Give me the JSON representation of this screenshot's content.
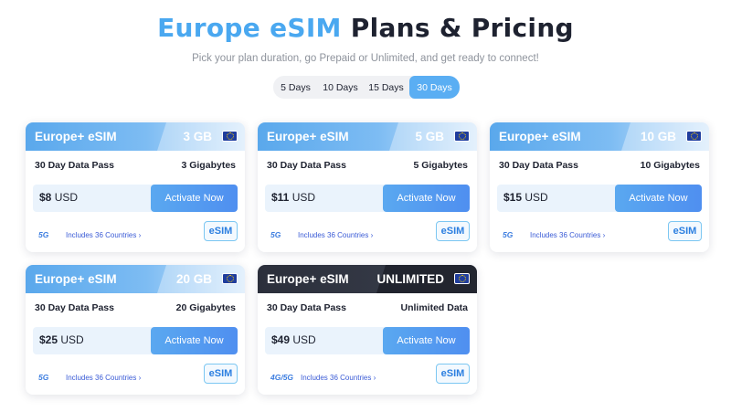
{
  "header": {
    "title_accent": "Europe eSIM",
    "title_rest": "Plans & Pricing",
    "subtitle": "Pick your plan duration, go Prepaid or Unlimited, and get ready to connect!"
  },
  "tabs": [
    {
      "label": "5 Days",
      "active": false
    },
    {
      "label": "10 Days",
      "active": false
    },
    {
      "label": "15 Days",
      "active": false
    },
    {
      "label": "30 Days",
      "active": true
    }
  ],
  "cards": [
    {
      "brand": "Europe+ eSIM",
      "data": "3 GB",
      "pass": "30 Day Data Pass",
      "amount": "3 Gigabytes",
      "price": "$8",
      "currency": "USD",
      "button": "Activate Now",
      "network": "5G",
      "countries": "Includes 36 Countries ›",
      "badge": "eSIM"
    },
    {
      "brand": "Europe+ eSIM",
      "data": "5 GB",
      "pass": "30 Day Data Pass",
      "amount": "5 Gigabytes",
      "price": "$11",
      "currency": "USD",
      "button": "Activate Now",
      "network": "5G",
      "countries": "Includes 36 Countries ›",
      "badge": "eSIM"
    },
    {
      "brand": "Europe+ eSIM",
      "data": "10 GB",
      "pass": "30 Day Data Pass",
      "amount": "10 Gigabytes",
      "price": "$15",
      "currency": "USD",
      "button": "Activate Now",
      "network": "5G",
      "countries": "Includes 36 Countries ›",
      "badge": "eSIM"
    },
    {
      "brand": "Europe+ eSIM",
      "data": "20 GB",
      "pass": "30 Day Data Pass",
      "amount": "20 Gigabytes",
      "price": "$25",
      "currency": "USD",
      "button": "Activate Now",
      "network": "5G",
      "countries": "Includes 36 Countries ›",
      "badge": "eSIM"
    },
    {
      "brand": "Europe+ eSIM",
      "data": "UNLIMITED",
      "pass": "30 Day Data Pass",
      "amount": "Unlimited Data",
      "price": "$49",
      "currency": "USD",
      "button": "Activate Now",
      "network": "4G/5G",
      "countries": "Includes 36 Countries ›",
      "badge": "eSIM"
    }
  ],
  "colors": {
    "accent": "#4aa8f0",
    "button": "#5aa8f0",
    "dark_header": "#2b2f3b",
    "text": "#1e2230"
  }
}
